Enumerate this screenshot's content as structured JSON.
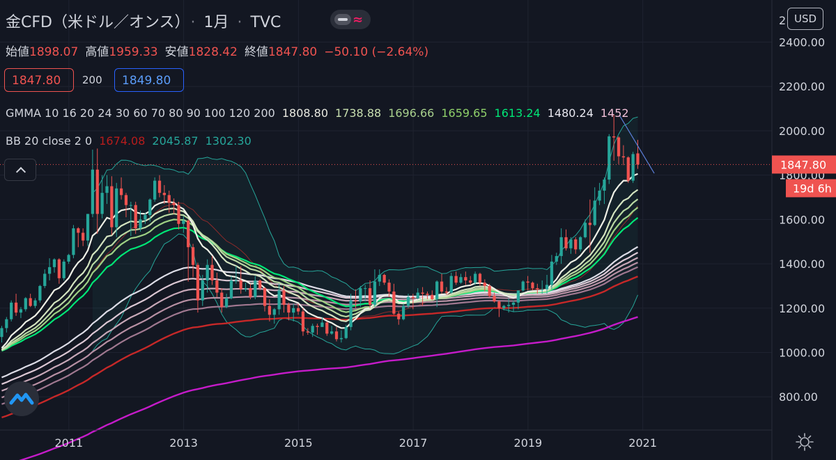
{
  "header": {
    "symbol": "金CFD（米ドル／オンス）",
    "interval": "1月",
    "source": "TVC",
    "currency": "USD"
  },
  "ohlc": {
    "open_label": "始値",
    "open": "1898.07",
    "high_label": "高値",
    "high": "1959.33",
    "low_label": "安値",
    "low": "1828.42",
    "close_label": "終値",
    "close": "1847.80",
    "change": "−50.10 (−2.64%)"
  },
  "trade": {
    "sell": "1847.80",
    "qty": "200",
    "buy": "1849.80"
  },
  "indicators": {
    "gmma_label": "GMMA 10 16 20 24 30 60 70 80 90 100 120 200",
    "gmma_values": [
      "1808.80",
      "1738.88",
      "1696.66",
      "1659.65",
      "1613.24",
      "1480.24",
      "1452"
    ],
    "gmma_colors": [
      "#e8e9e0",
      "#c8dfb0",
      "#a8d08d",
      "#8fd06a",
      "#00e676",
      "#e8e8f0",
      "#f1c0d8"
    ],
    "bb_label": "BB 20 close 2 0",
    "bb_values": [
      "1674.08",
      "2045.87",
      "1302.30"
    ],
    "bb_colors": [
      "#b71c1c",
      "#26a69a",
      "#26a69a"
    ]
  },
  "price_axis": {
    "last_price": "1847.80",
    "countdown": "19d 6h",
    "top_partial": "2",
    "ticks": [
      {
        "v": 2400,
        "label": "2400.00"
      },
      {
        "v": 2200,
        "label": "2200.00"
      },
      {
        "v": 2000,
        "label": "2000.00"
      },
      {
        "v": 1800,
        "label": "1800.00"
      },
      {
        "v": 1600,
        "label": "1600.00"
      },
      {
        "v": 1400,
        "label": "1400.00"
      },
      {
        "v": 1200,
        "label": "1200.00"
      },
      {
        "v": 1000,
        "label": "1000.00"
      },
      {
        "v": 800,
        "label": "800.00"
      }
    ]
  },
  "chart_data": {
    "type": "candlestick",
    "title": "金CFD（米ドル／オンス）",
    "x_ticks": [
      2011,
      2013,
      2015,
      2017,
      2019,
      2021
    ],
    "xlim": [
      2009.8,
      2023.25
    ],
    "ylim": [
      650,
      2590
    ],
    "last_price": 1847.8,
    "colors": {
      "up": "#26a69a",
      "down": "#ef5350",
      "bg": "#131722",
      "grid": "#1f2330"
    },
    "candles": [
      [
        1070,
        1120,
        1045,
        1110
      ],
      [
        1110,
        1160,
        1090,
        1150
      ],
      [
        1150,
        1235,
        1140,
        1225
      ],
      [
        1225,
        1265,
        1165,
        1180
      ],
      [
        1180,
        1205,
        1155,
        1195
      ],
      [
        1195,
        1250,
        1185,
        1245
      ],
      [
        1245,
        1265,
        1205,
        1210
      ],
      [
        1210,
        1245,
        1200,
        1235
      ],
      [
        1235,
        1305,
        1225,
        1300
      ],
      [
        1300,
        1375,
        1290,
        1355
      ],
      [
        1355,
        1425,
        1325,
        1385
      ],
      [
        1385,
        1425,
        1360,
        1420
      ],
      [
        1420,
        1425,
        1310,
        1335
      ],
      [
        1335,
        1420,
        1325,
        1410
      ],
      [
        1410,
        1445,
        1400,
        1440
      ],
      [
        1440,
        1575,
        1425,
        1560
      ],
      [
        1560,
        1565,
        1475,
        1540
      ],
      [
        1540,
        1560,
        1480,
        1505
      ],
      [
        1505,
        1625,
        1480,
        1625
      ],
      [
        1625,
        1915,
        1610,
        1825
      ],
      [
        1825,
        1920,
        1535,
        1625
      ],
      [
        1625,
        1800,
        1605,
        1720
      ],
      [
        1720,
        1800,
        1670,
        1750
      ],
      [
        1750,
        1795,
        1530,
        1565
      ],
      [
        1565,
        1765,
        1520,
        1740
      ],
      [
        1740,
        1790,
        1690,
        1710
      ],
      [
        1710,
        1720,
        1610,
        1665
      ],
      [
        1665,
        1680,
        1525,
        1665
      ],
      [
        1665,
        1680,
        1535,
        1560
      ],
      [
        1560,
        1640,
        1545,
        1600
      ],
      [
        1600,
        1630,
        1580,
        1620
      ],
      [
        1620,
        1695,
        1590,
        1690
      ],
      [
        1690,
        1790,
        1680,
        1775
      ],
      [
        1775,
        1800,
        1700,
        1720
      ],
      [
        1720,
        1755,
        1670,
        1710
      ],
      [
        1710,
        1730,
        1630,
        1675
      ],
      [
        1675,
        1695,
        1625,
        1665
      ],
      [
        1665,
        1680,
        1555,
        1580
      ],
      [
        1580,
        1615,
        1540,
        1595
      ],
      [
        1595,
        1600,
        1320,
        1475
      ],
      [
        1475,
        1490,
        1340,
        1395
      ],
      [
        1395,
        1405,
        1180,
        1235
      ],
      [
        1235,
        1350,
        1210,
        1325
      ],
      [
        1325,
        1420,
        1270,
        1395
      ],
      [
        1395,
        1435,
        1305,
        1325
      ],
      [
        1325,
        1360,
        1250,
        1270
      ],
      [
        1270,
        1290,
        1180,
        1205
      ],
      [
        1205,
        1265,
        1200,
        1245
      ],
      [
        1245,
        1345,
        1240,
        1325
      ],
      [
        1325,
        1390,
        1310,
        1325
      ],
      [
        1325,
        1390,
        1265,
        1285
      ],
      [
        1285,
        1315,
        1275,
        1290
      ],
      [
        1290,
        1310,
        1240,
        1250
      ],
      [
        1250,
        1345,
        1240,
        1325
      ],
      [
        1325,
        1330,
        1280,
        1290
      ],
      [
        1290,
        1295,
        1185,
        1210
      ],
      [
        1210,
        1240,
        1140,
        1170
      ],
      [
        1170,
        1200,
        1130,
        1195
      ],
      [
        1195,
        1310,
        1170,
        1280
      ],
      [
        1280,
        1300,
        1180,
        1215
      ],
      [
        1215,
        1225,
        1145,
        1180
      ],
      [
        1180,
        1220,
        1140,
        1200
      ],
      [
        1200,
        1220,
        1170,
        1185
      ],
      [
        1185,
        1200,
        1075,
        1095
      ],
      [
        1095,
        1110,
        1080,
        1090
      ],
      [
        1090,
        1130,
        1070,
        1120
      ],
      [
        1120,
        1130,
        1080,
        1115
      ],
      [
        1115,
        1160,
        1120,
        1135
      ],
      [
        1135,
        1140,
        1075,
        1085
      ],
      [
        1085,
        1120,
        1080,
        1095
      ],
      [
        1095,
        1115,
        1050,
        1060
      ],
      [
        1060,
        1100,
        1045,
        1065
      ],
      [
        1065,
        1125,
        1060,
        1115
      ],
      [
        1115,
        1265,
        1100,
        1235
      ],
      [
        1235,
        1285,
        1200,
        1230
      ],
      [
        1230,
        1300,
        1205,
        1290
      ],
      [
        1290,
        1305,
        1230,
        1290
      ],
      [
        1290,
        1325,
        1200,
        1215
      ],
      [
        1215,
        1375,
        1205,
        1320
      ],
      [
        1320,
        1375,
        1300,
        1350
      ],
      [
        1350,
        1355,
        1305,
        1315
      ],
      [
        1315,
        1330,
        1250,
        1275
      ],
      [
        1275,
        1310,
        1170,
        1175
      ],
      [
        1175,
        1185,
        1125,
        1150
      ],
      [
        1150,
        1220,
        1145,
        1210
      ],
      [
        1210,
        1265,
        1200,
        1250
      ],
      [
        1250,
        1265,
        1195,
        1245
      ],
      [
        1245,
        1290,
        1240,
        1270
      ],
      [
        1270,
        1295,
        1210,
        1265
      ],
      [
        1265,
        1275,
        1240,
        1260
      ],
      [
        1260,
        1280,
        1235,
        1240
      ],
      [
        1240,
        1325,
        1205,
        1320
      ],
      [
        1320,
        1355,
        1265,
        1275
      ],
      [
        1275,
        1295,
        1260,
        1270
      ],
      [
        1270,
        1360,
        1265,
        1345
      ],
      [
        1345,
        1365,
        1305,
        1315
      ],
      [
        1315,
        1355,
        1310,
        1340
      ],
      [
        1340,
        1365,
        1305,
        1325
      ],
      [
        1325,
        1345,
        1305,
        1315
      ],
      [
        1315,
        1365,
        1305,
        1355
      ],
      [
        1355,
        1360,
        1300,
        1315
      ],
      [
        1315,
        1330,
        1275,
        1300
      ],
      [
        1300,
        1310,
        1250,
        1255
      ],
      [
        1255,
        1270,
        1225,
        1230
      ],
      [
        1230,
        1235,
        1160,
        1200
      ],
      [
        1200,
        1215,
        1190,
        1210
      ],
      [
        1210,
        1245,
        1180,
        1215
      ],
      [
        1215,
        1235,
        1185,
        1225
      ],
      [
        1225,
        1250,
        1195,
        1280
      ],
      [
        1280,
        1325,
        1275,
        1320
      ],
      [
        1320,
        1345,
        1280,
        1315
      ],
      [
        1315,
        1320,
        1280,
        1290
      ],
      [
        1290,
        1310,
        1265,
        1285
      ],
      [
        1285,
        1325,
        1265,
        1285
      ],
      [
        1285,
        1350,
        1265,
        1305
      ],
      [
        1305,
        1440,
        1285,
        1410
      ],
      [
        1410,
        1450,
        1395,
        1435
      ],
      [
        1435,
        1560,
        1400,
        1520
      ],
      [
        1520,
        1555,
        1460,
        1470
      ],
      [
        1470,
        1520,
        1445,
        1510
      ],
      [
        1510,
        1520,
        1445,
        1465
      ],
      [
        1465,
        1525,
        1455,
        1520
      ],
      [
        1520,
        1600,
        1515,
        1585
      ],
      [
        1585,
        1690,
        1450,
        1575
      ],
      [
        1575,
        1745,
        1570,
        1685
      ],
      [
        1685,
        1765,
        1665,
        1730
      ],
      [
        1730,
        1790,
        1670,
        1780
      ],
      [
        1780,
        1985,
        1760,
        1975
      ],
      [
        1975,
        2075,
        1865,
        1970
      ],
      [
        1970,
        1975,
        1850,
        1885
      ],
      [
        1885,
        1935,
        1845,
        1880
      ],
      [
        1880,
        1885,
        1765,
        1775
      ],
      [
        1775,
        1905,
        1765,
        1895
      ],
      [
        1898.07,
        1959.33,
        1828.42,
        1847.8
      ]
    ],
    "gmma_short": [
      {
        "period": "10",
        "color": "#eef0e6",
        "end": 1808.8
      },
      {
        "period": "16",
        "color": "#d4e4c0",
        "end": 1738.88
      },
      {
        "period": "20",
        "color": "#b9d8a2",
        "end": 1696.66
      },
      {
        "period": "24",
        "color": "#9ed184",
        "end": 1659.65
      },
      {
        "period": "30",
        "color": "#00e676",
        "end": 1613.24
      }
    ],
    "gmma_long": [
      {
        "period": "60",
        "color": "#dcdce6",
        "end": 1480.24
      },
      {
        "period": "70",
        "color": "#dcc8d4",
        "end": 1452
      },
      {
        "period": "80",
        "color": "#c8a8b8",
        "end": 1430
      },
      {
        "period": "90",
        "color": "#b890a4",
        "end": 1408
      },
      {
        "period": "100",
        "color": "#a07890",
        "end": 1388
      },
      {
        "period": "120",
        "color": "#c62828",
        "end": 1335
      },
      {
        "period": "200",
        "color": "#c51bc9",
        "end": 1172
      }
    ],
    "bollinger": {
      "period": 20,
      "mult": 2,
      "basis": 1674.08,
      "upper": 2045.87,
      "lower": 1302.3,
      "color": "#26a69a"
    },
    "trendline": {
      "from": [
        2020.6,
        2067
      ],
      "to": [
        2021.2,
        1808
      ],
      "color": "#5b7fd8"
    }
  }
}
